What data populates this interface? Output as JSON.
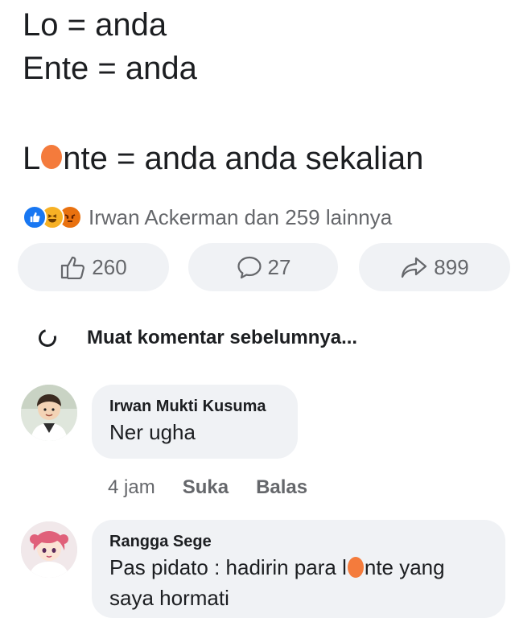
{
  "post": {
    "line1": "Lo = anda",
    "line2": "Ente = anda",
    "line3_prefix": "L",
    "line3_suffix": "nte = anda anda sekalian"
  },
  "reactions": {
    "icons": [
      "like-icon",
      "haha-icon",
      "angry-icon"
    ],
    "summary": "Irwan Ackerman dan 259 lainnya"
  },
  "actions": {
    "like_count": "260",
    "comment_count": "27",
    "share_count": "899"
  },
  "comments_header": {
    "load_more_label": "Muat komentar sebelumnya..."
  },
  "comments": [
    {
      "author": "Irwan Mukti Kusuma",
      "text": "Ner ugha",
      "time": "4 jam",
      "like_label": "Suka",
      "reply_label": "Balas"
    },
    {
      "author": "Rangga Sege",
      "text_prefix": "Pas pidato : hadirin para l",
      "text_suffix": "nte yang",
      "text_line2": "saya hormati"
    }
  ],
  "colors": {
    "accent": "#1877f2",
    "bubble": "#f0f2f5",
    "secondary_text": "#65676b",
    "censor_blot": "#f47b3c"
  }
}
